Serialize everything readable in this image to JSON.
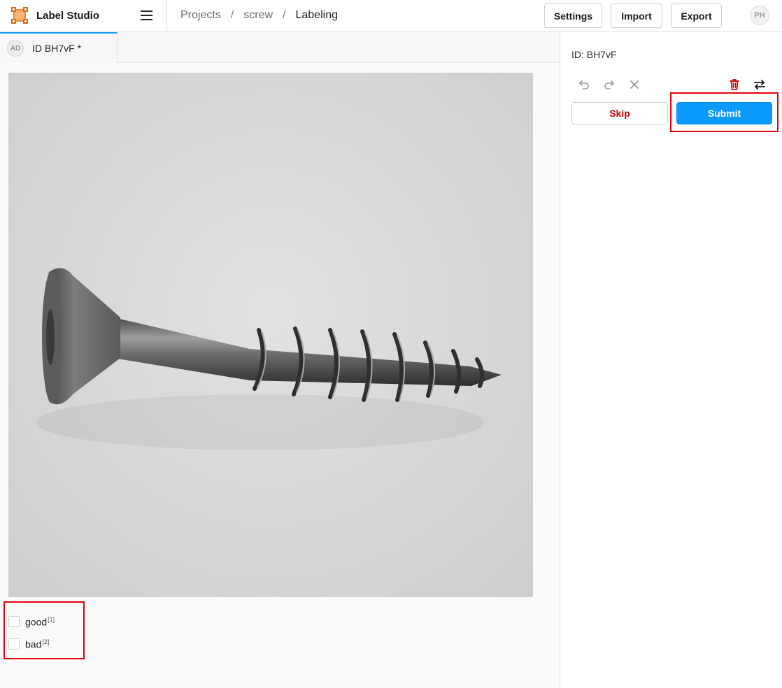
{
  "app": {
    "title": "Label Studio",
    "accent_color": "#f08a2c"
  },
  "breadcrumb": {
    "items": [
      "Projects",
      "screw"
    ],
    "current": "Labeling",
    "separator": "/"
  },
  "header": {
    "settings_label": "Settings",
    "import_label": "Import",
    "export_label": "Export",
    "user_initials": "PH"
  },
  "task_tab": {
    "avatar_initials": "AD",
    "label": "ID BH7vF *"
  },
  "image": {
    "subject": "screw",
    "icon": "image"
  },
  "choices": {
    "items": [
      {
        "label": "good",
        "hotkey": "[1]",
        "checked": false
      },
      {
        "label": "bad",
        "hotkey": "[2]",
        "checked": false
      }
    ]
  },
  "side_panel": {
    "task_id": "ID: BH7vF",
    "tools": {
      "undo_icon": "undo-icon",
      "redo_icon": "redo-icon",
      "reset_icon": "close-icon",
      "delete_icon": "trash-icon",
      "settings_icon": "sliders-icon"
    },
    "skip_label": "Skip",
    "submit_label": "Submit"
  },
  "colors": {
    "submit": "#0a99ff",
    "skip_text": "#d40000",
    "highlight": "#e3000b",
    "active_tab": "#1a9cf0"
  }
}
